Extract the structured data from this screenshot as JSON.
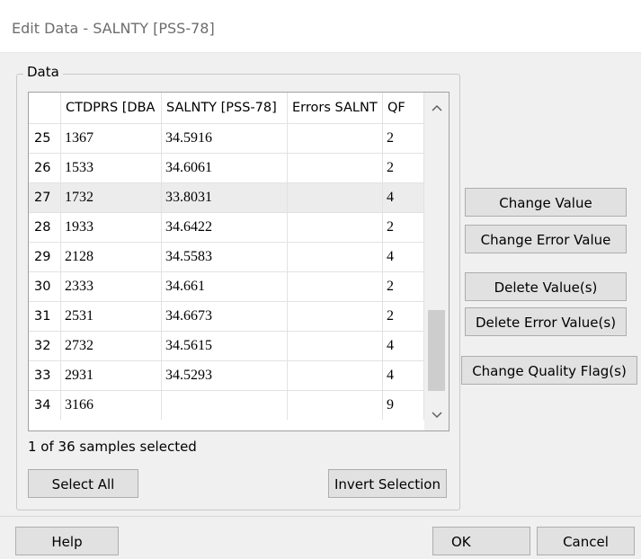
{
  "window": {
    "title": "Edit Data - SALNTY [PSS-78]"
  },
  "group": {
    "label": "Data"
  },
  "table": {
    "columns": [
      "CTDPRS [DBA",
      "SALNTY [PSS-78]",
      "Errors SALNT",
      "QF"
    ],
    "rows": [
      {
        "num": "25",
        "ctdprs": "1367",
        "salnty": "34.5916",
        "errors": "",
        "qf": "2",
        "selected": false
      },
      {
        "num": "26",
        "ctdprs": "1533",
        "salnty": "34.6061",
        "errors": "",
        "qf": "2",
        "selected": false
      },
      {
        "num": "27",
        "ctdprs": "1732",
        "salnty": "33.8031",
        "errors": "",
        "qf": "4",
        "selected": true
      },
      {
        "num": "28",
        "ctdprs": "1933",
        "salnty": "34.6422",
        "errors": "",
        "qf": "2",
        "selected": false
      },
      {
        "num": "29",
        "ctdprs": "2128",
        "salnty": "34.5583",
        "errors": "",
        "qf": "4",
        "selected": false
      },
      {
        "num": "30",
        "ctdprs": "2333",
        "salnty": "34.661",
        "errors": "",
        "qf": "2",
        "selected": false
      },
      {
        "num": "31",
        "ctdprs": "2531",
        "salnty": "34.6673",
        "errors": "",
        "qf": "2",
        "selected": false
      },
      {
        "num": "32",
        "ctdprs": "2732",
        "salnty": "34.5615",
        "errors": "",
        "qf": "4",
        "selected": false
      },
      {
        "num": "33",
        "ctdprs": "2931",
        "salnty": "34.5293",
        "errors": "",
        "qf": "4",
        "selected": false
      },
      {
        "num": "34",
        "ctdprs": "3166",
        "salnty": "",
        "errors": "",
        "qf": "9",
        "selected": false
      }
    ]
  },
  "status": {
    "text": "1 of 36 samples selected"
  },
  "buttons": {
    "select_all": "Select All",
    "invert_selection": "Invert Selection",
    "change_value": "Change Value",
    "change_error_value": "Change Error Value",
    "delete_values": "Delete Value(s)",
    "delete_error_values": "Delete Error Value(s)",
    "change_quality_flags": "Change Quality Flag(s)",
    "help": "Help",
    "ok": "OK",
    "cancel": "Cancel"
  },
  "icons": {
    "scroll_up": "chevron-up-icon",
    "scroll_down": "chevron-down-icon"
  },
  "colors": {
    "selected_row": "#ececec",
    "button_face": "#e1e1e1",
    "title_text": "#6d6d6d"
  }
}
